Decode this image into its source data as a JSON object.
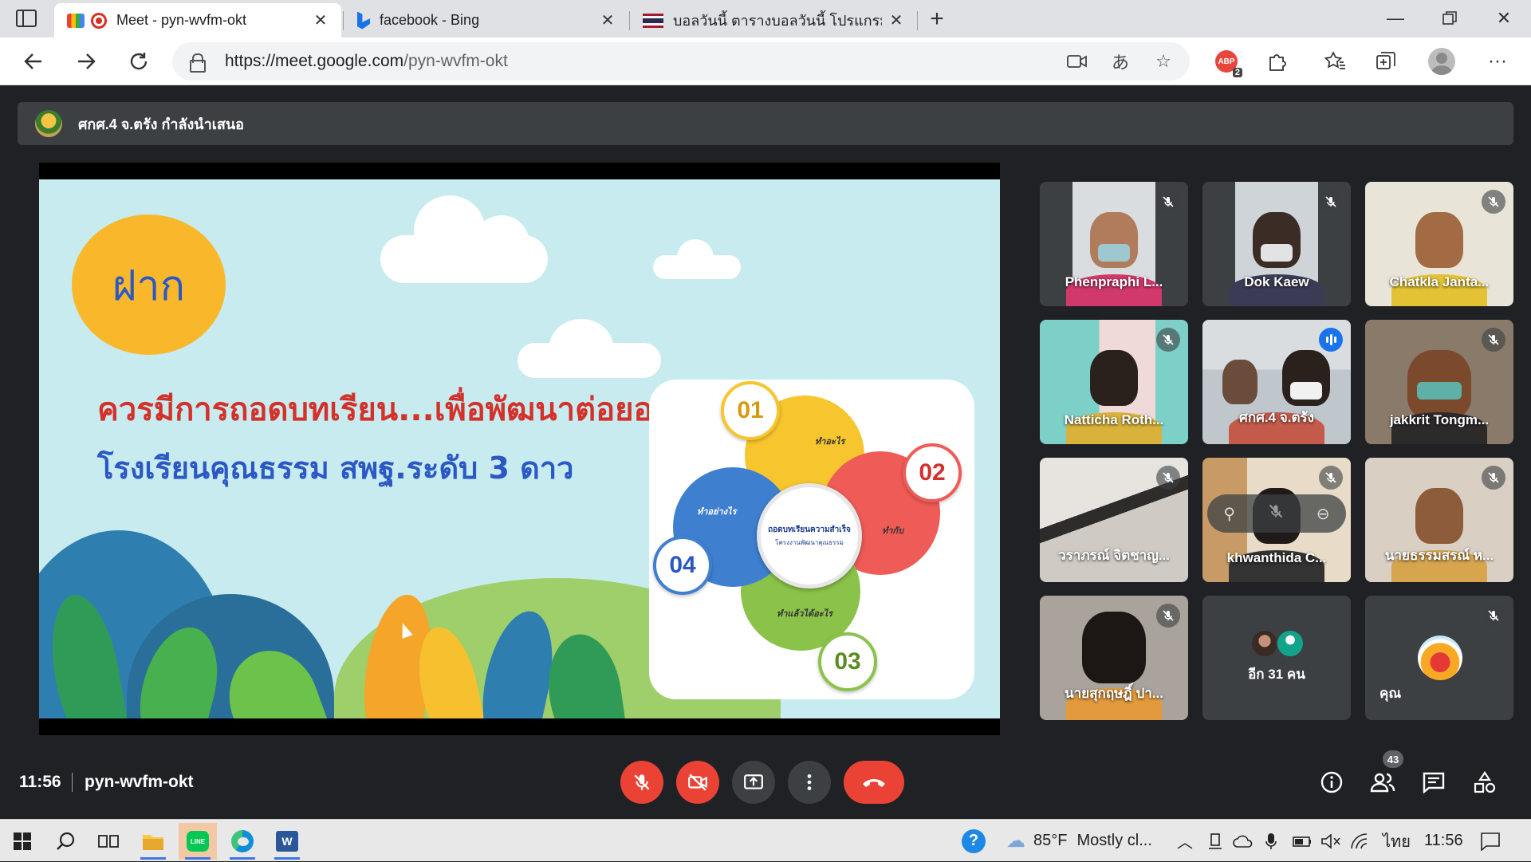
{
  "browser": {
    "tabs": [
      {
        "title": "Meet - pyn-wvfm-okt",
        "active": true
      },
      {
        "title": "facebook - Bing",
        "active": false
      },
      {
        "title": "บอลวันนี้ ตารางบอลวันนี้ โปรแกรมบอล",
        "active": false
      }
    ],
    "url_host": "https://meet.google.com",
    "url_path": "/pyn-wvfm-okt",
    "extension_badge": "2",
    "icons": {
      "back": "back-arrow-icon",
      "forward": "forward-arrow-icon",
      "reload": "reload-icon",
      "lock": "lock-icon",
      "camera": "camera-icon",
      "translate": "translate-icon",
      "add_favorite": "add-favorite-icon",
      "extensions": "puzzle-icon",
      "favorites": "favorites-icon",
      "collections": "collections-icon",
      "more": "more-dots-icon"
    },
    "translate_glyph": "あ"
  },
  "meet": {
    "presenter_text": "ศกศ.4 จ.ตรัง กำลังนำเสนอ",
    "slide": {
      "sun_text": "ฝาก",
      "heading1": "ควรมีการถอดบทเรียน...เพื่อพัฒนาต่อยอด",
      "heading2": "โรงเรียนคุณธรรม สพฐ.ระดับ 3 ดาว",
      "numbers": [
        "01",
        "02",
        "03",
        "04"
      ],
      "petal_labels": [
        "ทำอะไร",
        "ทำกับ",
        "ทำแล้วได้อะไร",
        "ทำอย่างไร"
      ],
      "center_title": "ถอดบทเรียนความสำเร็จ",
      "center_sub": "โครงงานพัฒนาคุณธรรม"
    },
    "participants": [
      {
        "name": "Phenpraphi L...",
        "muted": true
      },
      {
        "name": "Dok Kaew",
        "muted": true
      },
      {
        "name": "Chatkla Janta...",
        "muted": true
      },
      {
        "name": "Natticha Roth...",
        "muted": true
      },
      {
        "name": "ศกศ.4 จ.ตรัง",
        "muted": false,
        "speaking": true
      },
      {
        "name": "jakkrit Tongm...",
        "muted": true
      },
      {
        "name": "วราภรณ์ จิตชาญ...",
        "muted": true
      },
      {
        "name": "khwanthida C...",
        "muted": true
      },
      {
        "name": "นายธรรมสรณ์ ห...",
        "muted": true
      },
      {
        "name": "นายสุกฤษฎิ์ ปา...",
        "muted": true
      }
    ],
    "more_participants": "อีก 31 คน",
    "me_label": "คุณ",
    "time": "11:56",
    "meeting_code": "pyn-wvfm-okt",
    "people_count": "43",
    "colors": {
      "end_call": "#ea4335",
      "speaking_outline": "#8ab4f8",
      "background": "#202124"
    }
  },
  "taskbar": {
    "weather_temp": "85°F",
    "weather_desc": "Mostly cl...",
    "language": "ไทย",
    "clock": "11:56"
  }
}
